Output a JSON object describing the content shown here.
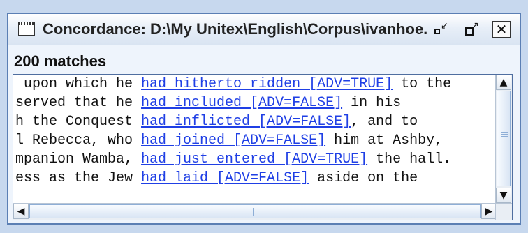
{
  "window": {
    "title": "Concordance: D:\\My Unitex\\English\\Corpus\\ivanhoe...",
    "buttons": {
      "iconify_symbol": "▫↙",
      "maximize_symbol": "▢↗",
      "close_symbol": "☒"
    }
  },
  "status": {
    "matches": "200 matches"
  },
  "concordance": {
    "lines": [
      {
        "left": " upon which he ",
        "match": "had hitherto ridden [ADV=TRUE]",
        "right": " to the"
      },
      {
        "left": "served that he ",
        "match": "had included [ADV=FALSE]",
        "right": " in his"
      },
      {
        "left": "h the Conquest ",
        "match": "had inflicted [ADV=FALSE]",
        "right": ", and to"
      },
      {
        "left": "l Rebecca, who ",
        "match": "had joined [ADV=FALSE]",
        "right": " him at Ashby,"
      },
      {
        "left": "mpanion Wamba, ",
        "match": "had just entered [ADV=TRUE]",
        "right": " the hall."
      },
      {
        "left": "ess as the Jew ",
        "match": "had laid [ADV=FALSE]",
        "right": " aside on the"
      }
    ]
  },
  "scrollbars": {
    "up_arrow": "▲",
    "down_arrow": "▼",
    "left_arrow": "◀",
    "right_arrow": "▶"
  },
  "colors": {
    "window_border": "#5b7fb4",
    "link": "#1f3fe5",
    "background": "#eef4fc"
  },
  "icons": {
    "window": "window-icon",
    "iconify": "iconify-icon",
    "maximize": "maximize-icon",
    "close": "close-icon",
    "scroll_up": "scroll-up-icon",
    "scroll_down": "scroll-down-icon",
    "scroll_left": "scroll-left-icon",
    "scroll_right": "scroll-right-icon"
  }
}
